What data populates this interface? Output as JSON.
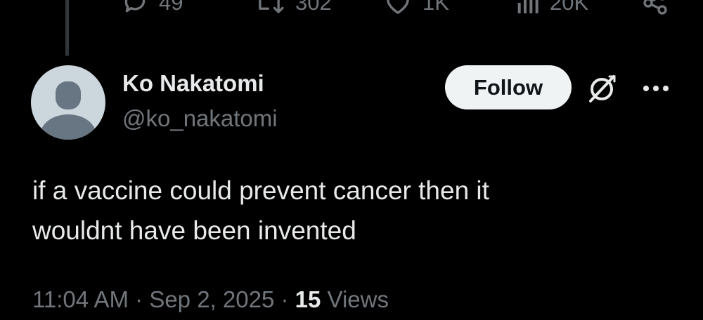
{
  "engagement": {
    "replies": "49",
    "reposts": "302",
    "likes": "1K",
    "views": "20K"
  },
  "user": {
    "display_name": "Ko Nakatomi",
    "handle": "@ko_nakatomi"
  },
  "follow_button": {
    "label": "Follow"
  },
  "tweet": {
    "line1": "if a vaccine could prevent cancer then it",
    "line2": "wouldnt have been invented"
  },
  "meta": {
    "time": "11:04 AM",
    "separator": " · ",
    "date": "Sep 2, 2025",
    "views_count": "15",
    "views_label": "Views"
  },
  "icons": {
    "reply": "reply-icon",
    "repost": "repost-icon",
    "like": "heart-icon",
    "views": "analytics-icon",
    "share": "share-icon",
    "grok": "grok-icon",
    "more": "more-icon"
  },
  "colors": {
    "background": "#000000",
    "primary_text": "#e7e9ea",
    "secondary_text": "#71767b",
    "follow_bg": "#eff3f4",
    "follow_text": "#0f1419",
    "avatar_bg": "#ccd6dd",
    "avatar_silhouette": "#687684",
    "thread_line": "#333639"
  }
}
